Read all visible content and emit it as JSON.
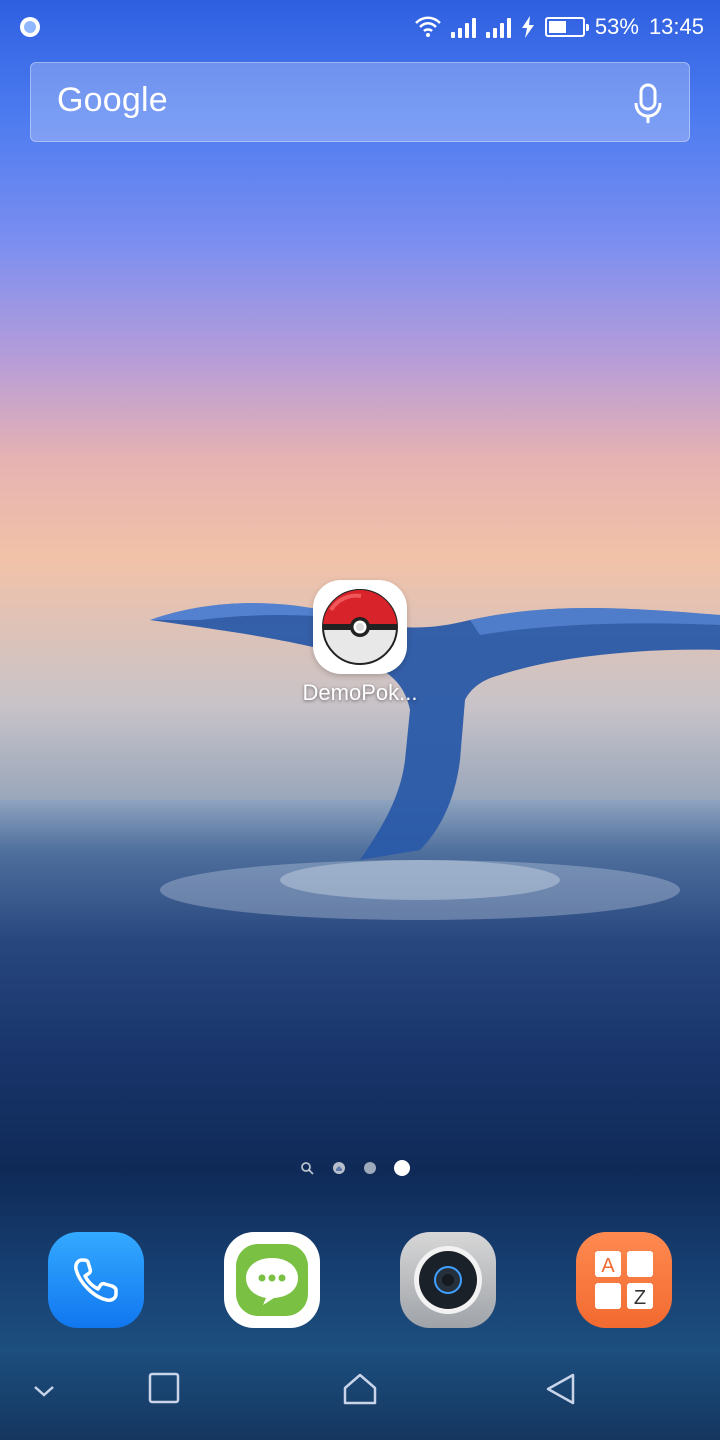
{
  "status_bar": {
    "battery_percent": "53%",
    "battery_level": 0.53,
    "time": "13:45",
    "icons": [
      "notification-circle-icon",
      "wifi-icon",
      "signal-icon",
      "signal-icon",
      "charging-icon",
      "battery-icon"
    ]
  },
  "search": {
    "logo_text": "Google",
    "mic_icon": "mic-icon"
  },
  "home": {
    "apps": [
      {
        "label": "DemoPok...",
        "icon": "pokeball-icon"
      }
    ]
  },
  "page_indicator": {
    "pages": 3,
    "current_page": 3,
    "icons": [
      "search-page-icon",
      "home-page-icon"
    ]
  },
  "dock": {
    "apps": [
      {
        "icon": "phone-icon",
        "color": "#1a8cf5"
      },
      {
        "icon": "messages-icon",
        "color": "#7ac043"
      },
      {
        "icon": "camera-icon",
        "color": "#b8bcc2"
      },
      {
        "icon": "az-icon",
        "color": "#f57a45"
      }
    ]
  },
  "nav_bar": {
    "buttons": [
      "collapse-icon",
      "recents-icon",
      "home-icon",
      "back-icon"
    ]
  }
}
